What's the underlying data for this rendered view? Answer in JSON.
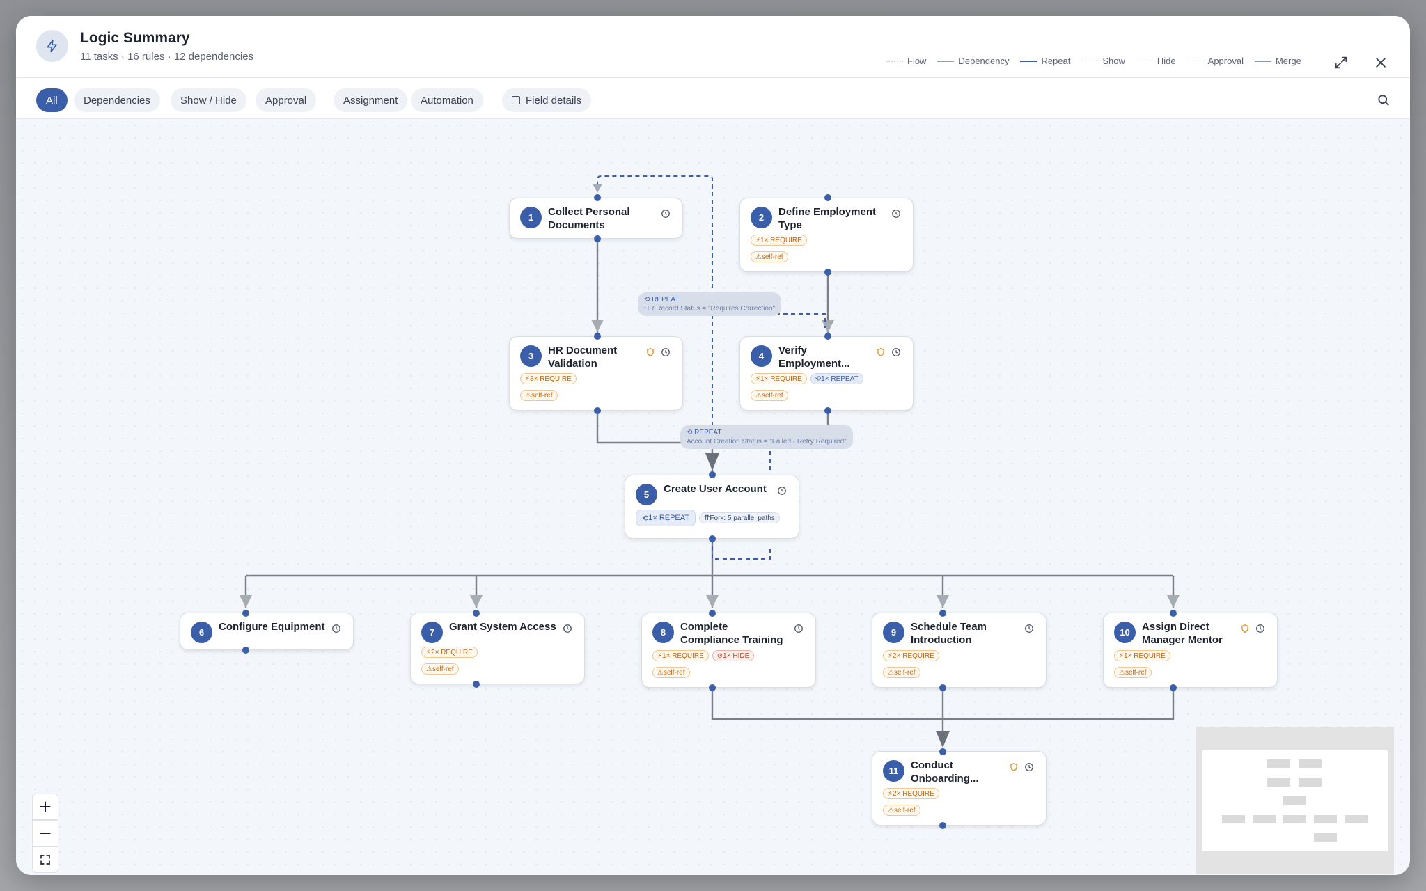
{
  "header": {
    "title": "Logic Summary",
    "subtitle": "11 tasks · 16 rules · 12 dependencies",
    "icon": "lightning-icon",
    "expand_icon": "expand-icon",
    "close_icon": "close-icon"
  },
  "legend": [
    {
      "label": "Flow",
      "color": "#cfd5df",
      "style": "dotted"
    },
    {
      "label": "Dependency",
      "color": "#9aa0a8",
      "style": "solid"
    },
    {
      "label": "Repeat",
      "color": "#3b5ea8",
      "style": "solid"
    },
    {
      "label": "Show",
      "color": "#2f9e8f",
      "style": "dashed"
    },
    {
      "label": "Hide",
      "color": "#d9583a",
      "style": "dashed"
    },
    {
      "label": "Approval",
      "color": "#e99a2c",
      "style": "dashed"
    },
    {
      "label": "Merge",
      "color": "#8a9bb0",
      "style": "solid"
    }
  ],
  "toolbar": {
    "filters": [
      "All",
      "Dependencies",
      "Show / Hide",
      "Approval",
      "Assignment",
      "Automation"
    ],
    "active_filter": "All",
    "field_details_label": "Field details",
    "search_icon": "search-icon"
  },
  "nodes": [
    {
      "id": "1",
      "title_lines": [
        "Collect Personal",
        "Documents"
      ],
      "approval": false,
      "tags": []
    },
    {
      "id": "2",
      "title_lines": [
        "Define Employment",
        "Type"
      ],
      "approval": false,
      "tags": [
        [
          "1× REQUIRE"
        ],
        [
          "self-ref"
        ]
      ]
    },
    {
      "id": "3",
      "title_lines": [
        "HR Document",
        "Validation"
      ],
      "approval": true,
      "tags": [
        [
          "3× REQUIRE"
        ],
        [
          "self-ref"
        ]
      ]
    },
    {
      "id": "4",
      "title_lines": [
        "Verify",
        "Employment..."
      ],
      "approval": true,
      "tags": [
        [
          "1× REQUIRE",
          "1× REPEAT"
        ],
        [
          "self-ref"
        ]
      ]
    },
    {
      "id": "5",
      "title_lines": [
        "Create User Account"
      ],
      "approval": false,
      "tags": [
        [
          "1× REPEAT",
          "Fork: 5 parallel paths"
        ]
      ]
    },
    {
      "id": "6",
      "title_lines": [
        "Configure Equipment"
      ],
      "approval": false,
      "tags": []
    },
    {
      "id": "7",
      "title_lines": [
        "Grant System Access"
      ],
      "approval": false,
      "tags": [
        [
          "2× REQUIRE"
        ],
        [
          "self-ref"
        ]
      ]
    },
    {
      "id": "8",
      "title_lines": [
        "Complete",
        "Compliance Training"
      ],
      "approval": false,
      "tags": [
        [
          "1× REQUIRE",
          "1× HIDE"
        ],
        [
          "self-ref"
        ]
      ]
    },
    {
      "id": "9",
      "title_lines": [
        "Schedule Team",
        "Introduction"
      ],
      "approval": false,
      "tags": [
        [
          "2× REQUIRE"
        ],
        [
          "self-ref"
        ]
      ]
    },
    {
      "id": "10",
      "title_lines": [
        "Assign Direct",
        "Manager Mentor"
      ],
      "approval": true,
      "tags": [
        [
          "1× REQUIRE"
        ],
        [
          "self-ref"
        ]
      ]
    },
    {
      "id": "11",
      "title_lines": [
        "Conduct",
        "Onboarding..."
      ],
      "approval": true,
      "tags": [
        [
          "2× REQUIRE"
        ],
        [
          "self-ref"
        ]
      ]
    }
  ],
  "edge_labels": [
    {
      "title": "REPEAT",
      "condition": "HR Record Status = \"Requires Correction\""
    },
    {
      "title": "REPEAT",
      "condition": "Account Creation Status = \"Failed - Retry Required\""
    }
  ],
  "zoom": {
    "in_icon": "plus-icon",
    "out_icon": "minus-icon",
    "fit_icon": "fit-screen-icon"
  }
}
